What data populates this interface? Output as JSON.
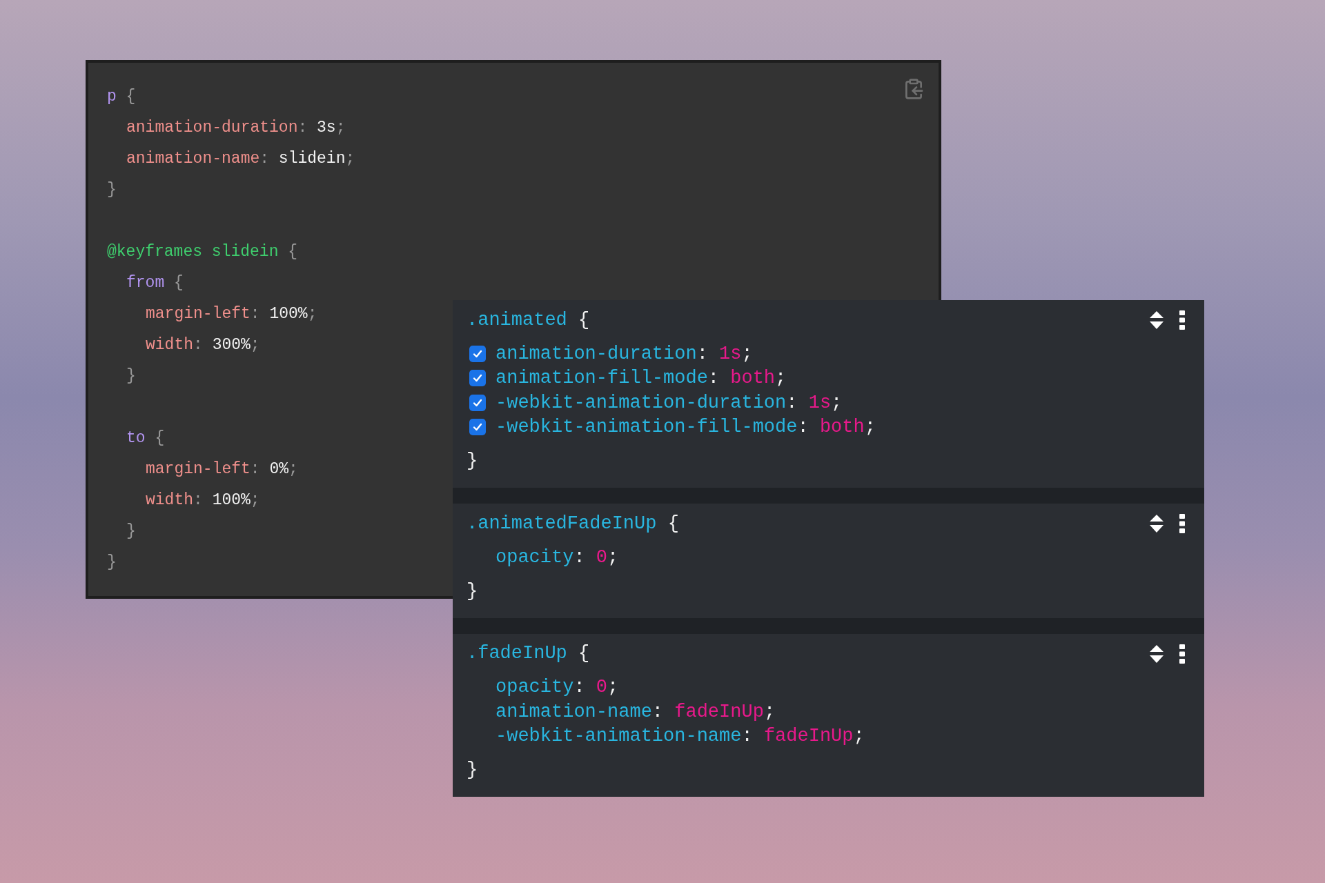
{
  "code_panel": {
    "lines": [
      {
        "kind": "code",
        "tokens": [
          {
            "kind": "selector",
            "text": "p"
          },
          {
            "kind": "punct",
            "text": " {"
          }
        ],
        "children": [
          {
            "kind": "code",
            "tokens": [
              {
                "kind": "property",
                "text": "animation-duration"
              },
              {
                "kind": "punct",
                "text": ": "
              },
              {
                "kind": "value",
                "text": "3s"
              },
              {
                "kind": "punct",
                "text": ";"
              }
            ]
          },
          {
            "kind": "code",
            "tokens": [
              {
                "kind": "property",
                "text": "animation-name"
              },
              {
                "kind": "punct",
                "text": ": "
              },
              {
                "kind": "value",
                "text": "slidein"
              },
              {
                "kind": "punct",
                "text": ";"
              }
            ]
          }
        ]
      },
      {
        "kind": "code",
        "tokens": [
          {
            "kind": "punct",
            "text": "}"
          }
        ]
      },
      {
        "kind": "blank"
      },
      {
        "kind": "code",
        "tokens": [
          {
            "kind": "atrule",
            "text": "@keyframes slidein"
          },
          {
            "kind": "punct",
            "text": " {"
          }
        ],
        "children": [
          {
            "kind": "code",
            "tokens": [
              {
                "kind": "selector",
                "text": "from"
              },
              {
                "kind": "punct",
                "text": " {"
              }
            ],
            "children": [
              {
                "kind": "code",
                "tokens": [
                  {
                    "kind": "property",
                    "text": "margin-left"
                  },
                  {
                    "kind": "punct",
                    "text": ": "
                  },
                  {
                    "kind": "value",
                    "text": "100%"
                  },
                  {
                    "kind": "punct",
                    "text": ";"
                  }
                ]
              },
              {
                "kind": "code",
                "tokens": [
                  {
                    "kind": "property",
                    "text": "width"
                  },
                  {
                    "kind": "punct",
                    "text": ": "
                  },
                  {
                    "kind": "value",
                    "text": "300%"
                  },
                  {
                    "kind": "punct",
                    "text": ";"
                  }
                ]
              }
            ]
          },
          {
            "kind": "code",
            "tokens": [
              {
                "kind": "punct",
                "text": "}"
              }
            ]
          },
          {
            "kind": "blank"
          },
          {
            "kind": "code",
            "tokens": [
              {
                "kind": "selector",
                "text": "to"
              },
              {
                "kind": "punct",
                "text": " {"
              }
            ],
            "children": [
              {
                "kind": "code",
                "tokens": [
                  {
                    "kind": "property",
                    "text": "margin-left"
                  },
                  {
                    "kind": "punct",
                    "text": ": "
                  },
                  {
                    "kind": "value",
                    "text": "0%"
                  },
                  {
                    "kind": "punct",
                    "text": ";"
                  }
                ]
              },
              {
                "kind": "code",
                "tokens": [
                  {
                    "kind": "property",
                    "text": "width"
                  },
                  {
                    "kind": "punct",
                    "text": ": "
                  },
                  {
                    "kind": "value",
                    "text": "100%"
                  },
                  {
                    "kind": "punct",
                    "text": ";"
                  }
                ]
              }
            ]
          },
          {
            "kind": "code",
            "tokens": [
              {
                "kind": "punct",
                "text": "}"
              }
            ]
          }
        ]
      },
      {
        "kind": "code",
        "tokens": [
          {
            "kind": "punct",
            "text": "}"
          }
        ]
      }
    ]
  },
  "styles_panel": {
    "rules": [
      {
        "selector": ".animated",
        "open": "{",
        "close": "}",
        "declarations": [
          {
            "kind": "toggle",
            "checked": true,
            "property": "animation-duration",
            "colon": ":",
            "value": "1s",
            "semicolon": ";"
          },
          {
            "kind": "toggle",
            "checked": true,
            "property": "animation-fill-mode",
            "colon": ":",
            "value": "both",
            "semicolon": ";"
          },
          {
            "kind": "toggle",
            "checked": true,
            "property": "-webkit-animation-duration",
            "colon": ":",
            "value": "1s",
            "semicolon": ";"
          },
          {
            "kind": "toggle",
            "checked": true,
            "property": "-webkit-animation-fill-mode",
            "colon": ":",
            "value": "both",
            "semicolon": ";"
          }
        ]
      },
      {
        "selector": ".animatedFadeInUp",
        "open": "{",
        "close": "}",
        "declarations": [
          {
            "kind": "plain",
            "property": "opacity",
            "colon": ":",
            "value": "0",
            "semicolon": ";"
          }
        ]
      },
      {
        "selector": ".fadeInUp",
        "open": "{",
        "close": "}",
        "declarations": [
          {
            "kind": "plain",
            "property": "opacity",
            "colon": ":",
            "value": "0",
            "semicolon": ";"
          },
          {
            "kind": "plain",
            "property": "animation-name",
            "colon": ":",
            "value": "fadeInUp",
            "semicolon": ";"
          },
          {
            "kind": "plain",
            "property": "-webkit-animation-name",
            "colon": ":",
            "value": "fadeInUp",
            "semicolon": ";"
          }
        ]
      }
    ]
  }
}
